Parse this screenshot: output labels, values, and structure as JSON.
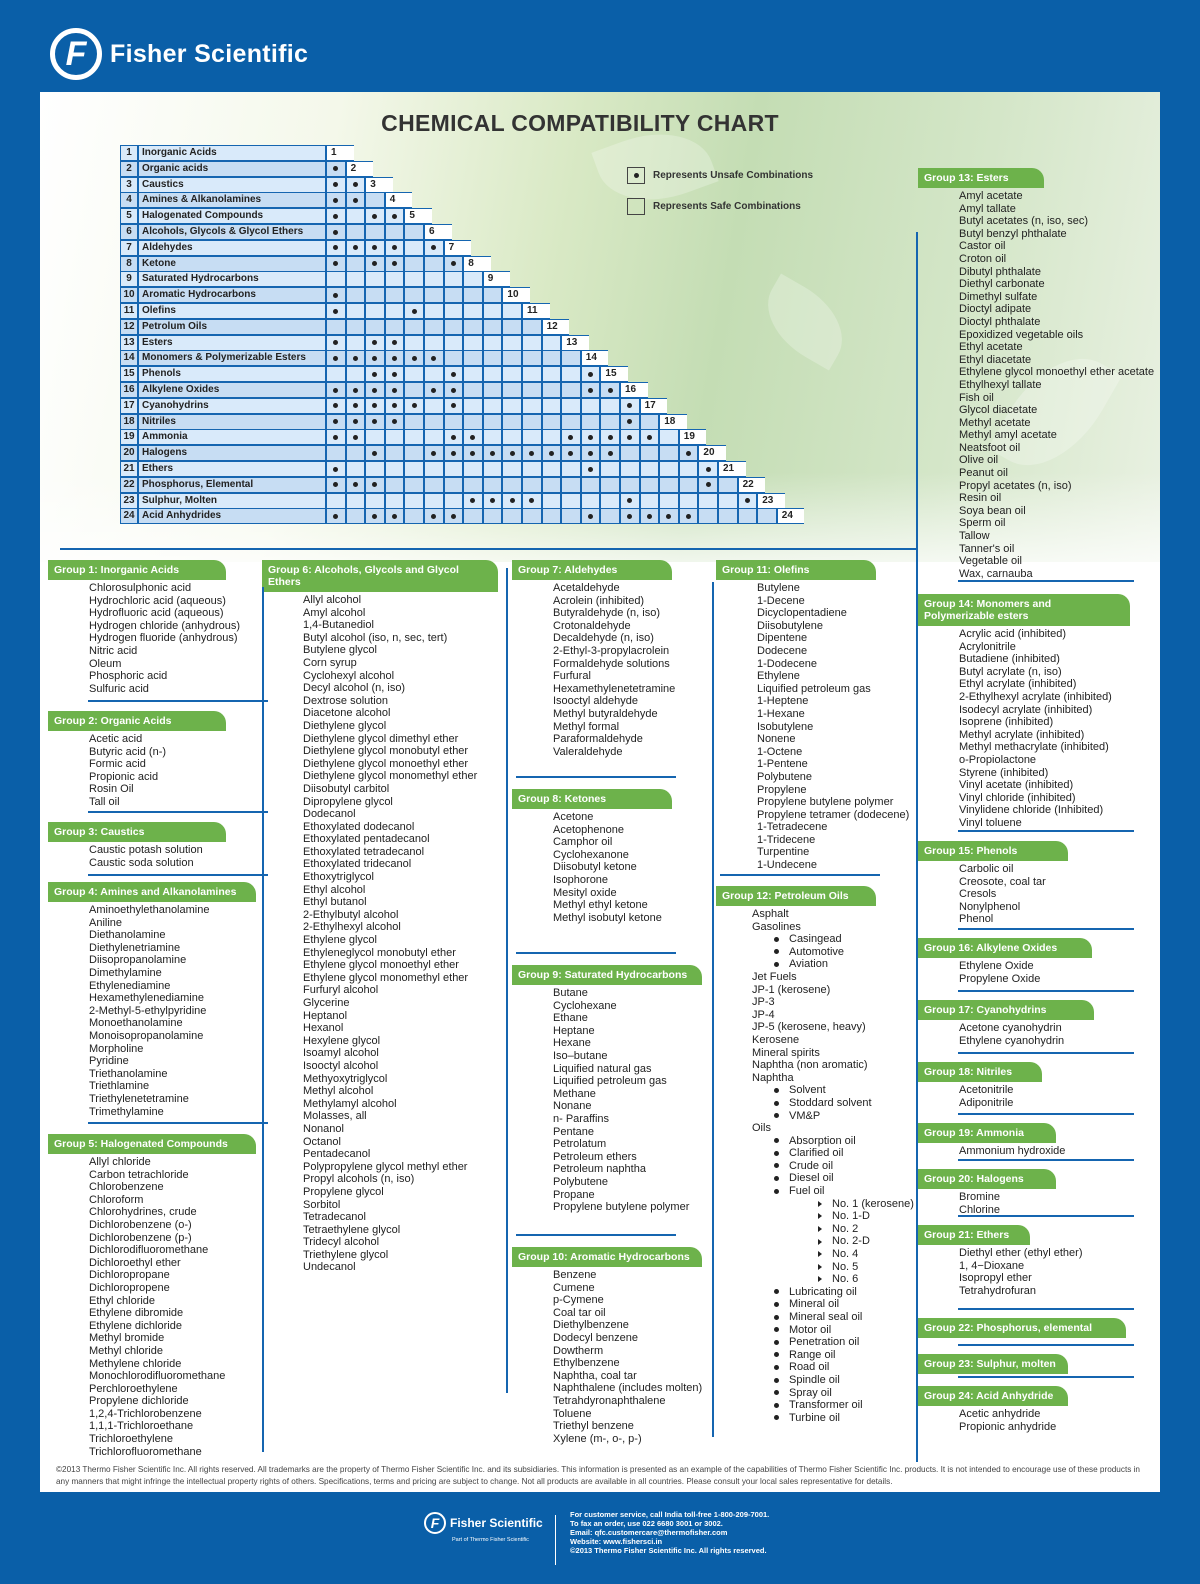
{
  "header": {
    "brand": "Fisher Scientific",
    "logo_letter": "F"
  },
  "title": "CHEMICAL COMPATIBILITY CHART",
  "legend": {
    "unsafe": "Represents Unsafe Combinations",
    "safe": "Represents Safe Combinations"
  },
  "matrix": {
    "groups": [
      "Inorganic Acids",
      "Organic acids",
      "Caustics",
      "Amines & Alkanolamines",
      "Halogenated Compounds",
      "Alcohols, Glycols & Glycol Ethers",
      "Aldehydes",
      "Ketone",
      "Saturated Hydrocarbons",
      "Aromatic Hydrocarbons",
      "Olefins",
      "Petrolum Oils",
      "Esters",
      "Monomers & Polymerizable Esters",
      "Phenols",
      "Alkylene Oxides",
      "Cyanohydrins",
      "Nitriles",
      "Ammonia",
      "Halogens",
      "Ethers",
      "Phosphorus, Elemental",
      "Sulphur, Molten",
      "Acid Anhydrides"
    ],
    "unsafe": [
      [],
      [
        1
      ],
      [
        1,
        2
      ],
      [
        1,
        2
      ],
      [
        1,
        3,
        4
      ],
      [
        1
      ],
      [
        1,
        2,
        3,
        4,
        6
      ],
      [
        1,
        3,
        4,
        7
      ],
      [],
      [
        1
      ],
      [
        1,
        5
      ],
      [],
      [
        1,
        3,
        4
      ],
      [
        1,
        2,
        3,
        4,
        5,
        6
      ],
      [
        3,
        4,
        7,
        14
      ],
      [
        1,
        2,
        3,
        4,
        6,
        7,
        14,
        15
      ],
      [
        1,
        2,
        3,
        4,
        5,
        7,
        16
      ],
      [
        1,
        2,
        3,
        4,
        16
      ],
      [
        1,
        2,
        7,
        8,
        13,
        14,
        15,
        16,
        17
      ],
      [
        3,
        6,
        7,
        8,
        9,
        10,
        11,
        12,
        13,
        14,
        15,
        19
      ],
      [
        1,
        14,
        20
      ],
      [
        1,
        2,
        3,
        20
      ],
      [
        8,
        9,
        10,
        11,
        16,
        22
      ],
      [
        1,
        3,
        4,
        6,
        7,
        14,
        16,
        17,
        18,
        19
      ]
    ]
  },
  "groups": [
    {
      "title": "Group 1: Inorganic Acids",
      "items": [
        "Chlorosulphonic acid",
        "Hydrochloric acid (aqueous)",
        "Hydrofluoric acid (aqueous)",
        "Hydrogen chloride (anhydrous)",
        "Hydrogen fluoride (anhydrous)",
        "Nitric acid",
        "Oleum",
        "Phosphoric acid",
        "Sulfuric acid"
      ]
    },
    {
      "title": "Group 2: Organic Acids",
      "items": [
        "Acetic acid",
        "Butyric acid (n-)",
        "Formic acid",
        "Propionic acid",
        "Rosin Oil",
        "Tall oil"
      ]
    },
    {
      "title": "Group 3: Caustics",
      "items": [
        "Caustic potash solution",
        "Caustic soda solution"
      ]
    },
    {
      "title": "Group 4: Amines and Alkanolamines",
      "items": [
        "Aminoethylethanolamine",
        "Aniline",
        "Diethanolamine",
        "Diethylenetriamine",
        "Diisopropanolamine",
        "Dimethylamine",
        "Ethylenediamine",
        "Hexamethylenediamine",
        "2-Methyl-5-ethylpyridine",
        "Monoethanolamine",
        "Monoisopropanolamine",
        "Morpholine",
        "Pyridine",
        "Triethanolamine",
        "Triethlamine",
        "Triethylenetetramine",
        "Trimethylamine"
      ]
    },
    {
      "title": "Group 5: Halogenated Compounds",
      "items": [
        "Allyl chloride",
        "Carbon tetrachloride",
        "Chlorobenzene",
        "Chloroform",
        "Chlorohydrines, crude",
        "Dichlorobenzene (o-)",
        "Dichlorobenzene (p-)",
        "Dichlorodifluoromethane",
        "Dichloroethyl ether",
        "Dichloropropane",
        "Dichloropropene",
        "Ethyl chloride",
        "Ethylene dibromide",
        "Ethylene dichloride",
        "Methyl bromide",
        "Methyl chloride",
        "Methylene chloride",
        "Monochlorodifluoromethane",
        "Perchloroethylene",
        "Propylene dichloride",
        "1,2,4-Trichlorobenzene",
        "1,1,1-Trichloroethane",
        "Trichloroethylene",
        "Trichlorofluoromethane"
      ]
    },
    {
      "title": "Group 6: Alcohols, Glycols and Glycol Ethers",
      "items": [
        "Allyl alcohol",
        "Amyl alcohol",
        "1,4-Butanediol",
        "Butyl alcohol (iso, n, sec, tert)",
        "Butylene glycol",
        "Corn syrup",
        "Cyclohexyl alcohol",
        "Decyl alcohol (n, iso)",
        "Dextrose solution",
        "Diacetone alcohol",
        "Diethylene glycol",
        "Diethylene glycol dimethyl ether",
        "Diethylene glycol monobutyl ether",
        "Diethylene glycol monoethyl ether",
        "Diethylene glycol monomethyl ether",
        "Diisobutyl carbitol",
        "Dipropylene glycol",
        "Dodecanol",
        "Ethoxylated dodecanol",
        "Ethoxylated pentadecanol",
        "Ethoxylated tetradecanol",
        "Ethoxylated tridecanol",
        "Ethoxytriglycol",
        "Ethyl alcohol",
        "Ethyl butanol",
        "2-Ethylbutyl alcohol",
        "2-Ethylhexyl alcohol",
        "Ethylene glycol",
        "Ethyleneglycol monobutyl ether",
        "Ethylene glycol monoethyl ether",
        "Ethylene glycol monomethyl ether",
        "Furfuryl alcohol",
        "Glycerine",
        "Heptanol",
        "Hexanol",
        "Hexylene glycol",
        "Isoamyl alcohol",
        "Isooctyl alcohol",
        "Methyoxytriglycol",
        "Methyl alcohol",
        "Methylamyl alcohol",
        "Molasses, all",
        "Nonanol",
        "Octanol",
        "Pentadecanol",
        "Polypropylene glycol methyl ether",
        "Propyl alcohols (n, iso)",
        "Propylene glycol",
        "Sorbitol",
        "Tetradecanol",
        "Tetraethylene glycol",
        "Tridecyl alcohol",
        "Triethylene glycol",
        "Undecanol"
      ]
    },
    {
      "title": "Group 7: Aldehydes",
      "items": [
        "Acetaldehyde",
        "Acrolein (inhibited)",
        "Butyraldehyde (n, iso)",
        "Crotonaldehyde",
        "Decaldehyde (n, iso)",
        "2-Ethyl-3-propylacrolein",
        "Formaldehyde solutions",
        "Furfural",
        "Hexamethylenetetramine",
        "Isooctyl aldehyde",
        "Methyl butyraldehyde",
        "Methyl formal",
        "Paraformaldehyde",
        "Valeraldehyde"
      ]
    },
    {
      "title": "Group 8: Ketones",
      "items": [
        "Acetone",
        "Acetophenone",
        "Camphor oil",
        "Cyclohexanone",
        "Diisobutyl ketone",
        "Isophorone",
        "Mesityl oxide",
        "Methyl ethyl ketone",
        "Methyl isobutyl ketone"
      ]
    },
    {
      "title": "Group 9: Saturated Hydrocarbons",
      "items": [
        "Butane",
        "Cyclohexane",
        "Ethane",
        "Heptane",
        "Hexane",
        "Iso–butane",
        "Liquified natural gas",
        "Liquified petroleum gas",
        "Methane",
        "Nonane",
        "n- Paraffins",
        "Pentane",
        "Petrolatum",
        "Petroleum ethers",
        "Petroleum naphtha",
        "Polybutene",
        "Propane",
        "Propylene butylene polymer"
      ]
    },
    {
      "title": "Group 10: Aromatic Hydrocarbons",
      "items": [
        "Benzene",
        "Cumene",
        "p-Cymene",
        "Coal tar oil",
        "Diethylbenzene",
        "Dodecyl benzene",
        "Dowtherm",
        "Ethylbenzene",
        "Naphtha, coal tar",
        "Naphthalene (includes molten)",
        "Tetrahdyronaphthalene",
        "Toluene",
        "Triethyl benzene",
        "Xylene (m-, o-, p-)"
      ]
    },
    {
      "title": "Group 11: Olefins",
      "items": [
        "Butylene",
        "1-Decene",
        "Dicyclopentadiene",
        "Diisobutylene",
        "Dipentene",
        "Dodecene",
        "1-Dodecene",
        "Ethylene",
        "Liquified petroleum gas",
        "1-Heptene",
        "1-Hexane",
        "Isobutylene",
        "Nonene",
        "1-Octene",
        "1-Pentene",
        "Polybutene",
        "Propylene",
        "Propylene butylene polymer",
        "Propylene tetramer (dodecene)",
        "1-Tetradecene",
        "1-Tridecene",
        "Turpentine",
        "1-Undecene"
      ]
    },
    {
      "title": "Group 12: Petroleum Oils",
      "items": [
        {
          "t": "Asphalt",
          "l": 0
        },
        {
          "t": "Gasolines",
          "l": 0
        },
        {
          "t": "Casingead",
          "l": 1
        },
        {
          "t": "Automotive",
          "l": 1
        },
        {
          "t": "Aviation",
          "l": 1
        },
        {
          "t": "Jet Fuels",
          "l": 0
        },
        {
          "t": "JP-1 (kerosene)",
          "l": 0
        },
        {
          "t": "JP-3",
          "l": 0
        },
        {
          "t": "JP-4",
          "l": 0
        },
        {
          "t": "JP-5 (kerosene, heavy)",
          "l": 0
        },
        {
          "t": "Kerosene",
          "l": 0
        },
        {
          "t": "Mineral spirits",
          "l": 0
        },
        {
          "t": "Naphtha (non aromatic)",
          "l": 0
        },
        {
          "t": "Naphtha",
          "l": 0
        },
        {
          "t": "Solvent",
          "l": 1
        },
        {
          "t": "Stoddard solvent",
          "l": 1
        },
        {
          "t": "VM&P",
          "l": 1
        },
        {
          "t": "Oils",
          "l": 0
        },
        {
          "t": "Absorption oil",
          "l": 1
        },
        {
          "t": "Clarified oil",
          "l": 1
        },
        {
          "t": "Crude oil",
          "l": 1
        },
        {
          "t": "Diesel oil",
          "l": 1
        },
        {
          "t": "Fuel oil",
          "l": 1
        },
        {
          "t": "No. 1 (kerosene)",
          "l": 2
        },
        {
          "t": "No. 1-D",
          "l": 2
        },
        {
          "t": "No. 2",
          "l": 2
        },
        {
          "t": "No. 2-D",
          "l": 2
        },
        {
          "t": "No. 4",
          "l": 2
        },
        {
          "t": "No. 5",
          "l": 2
        },
        {
          "t": "No. 6",
          "l": 2
        },
        {
          "t": "Lubricating oil",
          "l": 1
        },
        {
          "t": "Mineral oil",
          "l": 1
        },
        {
          "t": "Mineral seal oil",
          "l": 1
        },
        {
          "t": "Motor oil",
          "l": 1
        },
        {
          "t": "Penetration oil",
          "l": 1
        },
        {
          "t": "Range oil",
          "l": 1
        },
        {
          "t": "Road oil",
          "l": 1
        },
        {
          "t": "Spindle oil",
          "l": 1
        },
        {
          "t": "Spray oil",
          "l": 1
        },
        {
          "t": "Transformer oil",
          "l": 1
        },
        {
          "t": "Turbine oil",
          "l": 1
        }
      ]
    },
    {
      "title": "Group 13: Esters",
      "items": [
        "Amyl acetate",
        "Amyl tallate",
        "Butyl acetates (n, iso, sec)",
        "Butyl benzyl phthalate",
        "Castor oil",
        "Croton oil",
        "Dibutyl phthalate",
        "Diethyl carbonate",
        "Dimethyl sulfate",
        "Dioctyl adipate",
        "Dioctyl phthalate",
        "Epoxidized vegetable oils",
        "Ethyl acetate",
        "Ethyl diacetate",
        "Ethylene glycol monoethyl ether acetate",
        "Ethylhexyl tallate",
        "Fish oil",
        "Glycol diacetate",
        "Methyl acetate",
        "Methyl amyl acetate",
        "Neatsfoot oil",
        "Olive oil",
        "Peanut oil",
        "Propyl acetates (n, iso)",
        "Resin oil",
        "Soya bean oil",
        "Sperm oil",
        "Tallow",
        "Tanner's oil",
        "Vegetable oil",
        "Wax, carnauba"
      ]
    },
    {
      "title": "Group 14: Monomers and Polymerizable esters",
      "items": [
        "Acrylic acid (inhibited)",
        "Acrylonitrile",
        "Butadiene (inhibited)",
        "Butyl acrylate (n, iso)",
        "Ethyl acrylate (inhibited)",
        "2-Ethylhexyl acrylate (inhibited)",
        "Isodecyl acrylate (inhibited)",
        "Isoprene (inhibited)",
        "Methyl acrylate (inhibited)",
        "Methyl methacrylate (inhibited)",
        "o-Propiolactone",
        "Styrene (inhibited)",
        "Vinyl acetate (inhibited)",
        "Vinyl chloride (inhibited)",
        "Vinylidene chloride (Inhibited)",
        "Vinyl toluene"
      ]
    },
    {
      "title": "Group 15: Phenols",
      "items": [
        "Carbolic oil",
        "Creosote, coal tar",
        "Cresols",
        "Nonylphenol",
        "Phenol"
      ]
    },
    {
      "title": "Group 16: Alkylene Oxides",
      "items": [
        "Ethylene Oxide",
        "Propylene Oxide"
      ]
    },
    {
      "title": "Group 17: Cyanohydrins",
      "items": [
        "Acetone cyanohydrin",
        "Ethylene cyanohydrin"
      ]
    },
    {
      "title": "Group 18: Nitriles",
      "items": [
        "Acetonitrile",
        "Adiponitrile"
      ]
    },
    {
      "title": "Group 19: Ammonia",
      "items": [
        "Ammonium hydroxide"
      ]
    },
    {
      "title": "Group 20: Halogens",
      "items": [
        "Bromine",
        "Chlorine"
      ]
    },
    {
      "title": "Group 21: Ethers",
      "items": [
        "Diethyl ether (ethyl ether)",
        "1, 4−Dioxane",
        "Isopropyl ether",
        "Tetrahydrofuran"
      ]
    },
    {
      "title": "Group 22: Phosphorus, elemental",
      "items": []
    },
    {
      "title": "Group 23: Sulphur, molten",
      "items": []
    },
    {
      "title": "Group 24: Acid Anhydride",
      "items": [
        "Acetic anhydride",
        "Propionic anhydride"
      ]
    }
  ],
  "copyright": "©2013 Thermo Fisher Scientific Inc. All rights reserved. All trademarks are the property of Thermo Fisher Scientific Inc. and its subsidiaries. This information is presented as an example of the capabilities of Thermo Fisher Scientific Inc. products. It is not intended to encourage use of these products in any manners that might infringe the intellectual property rights of others. Specifications, terms and pricing are subject to change. Not all products are available in all countries. Please consult your local sales representative for details.",
  "footer": {
    "brand": "Fisher Scientific",
    "tagline": "Part of Thermo Fisher Scientific",
    "contact": [
      "For customer service, call India toll-free 1-800-209-7001.",
      "To fax an order, use 022 6680 3001 or 3002.",
      "Email: qfc.customercare@thermofisher.com",
      "Website: www.fishersci.in",
      "©2013 Thermo Fisher Scientific Inc. All rights reserved."
    ]
  }
}
